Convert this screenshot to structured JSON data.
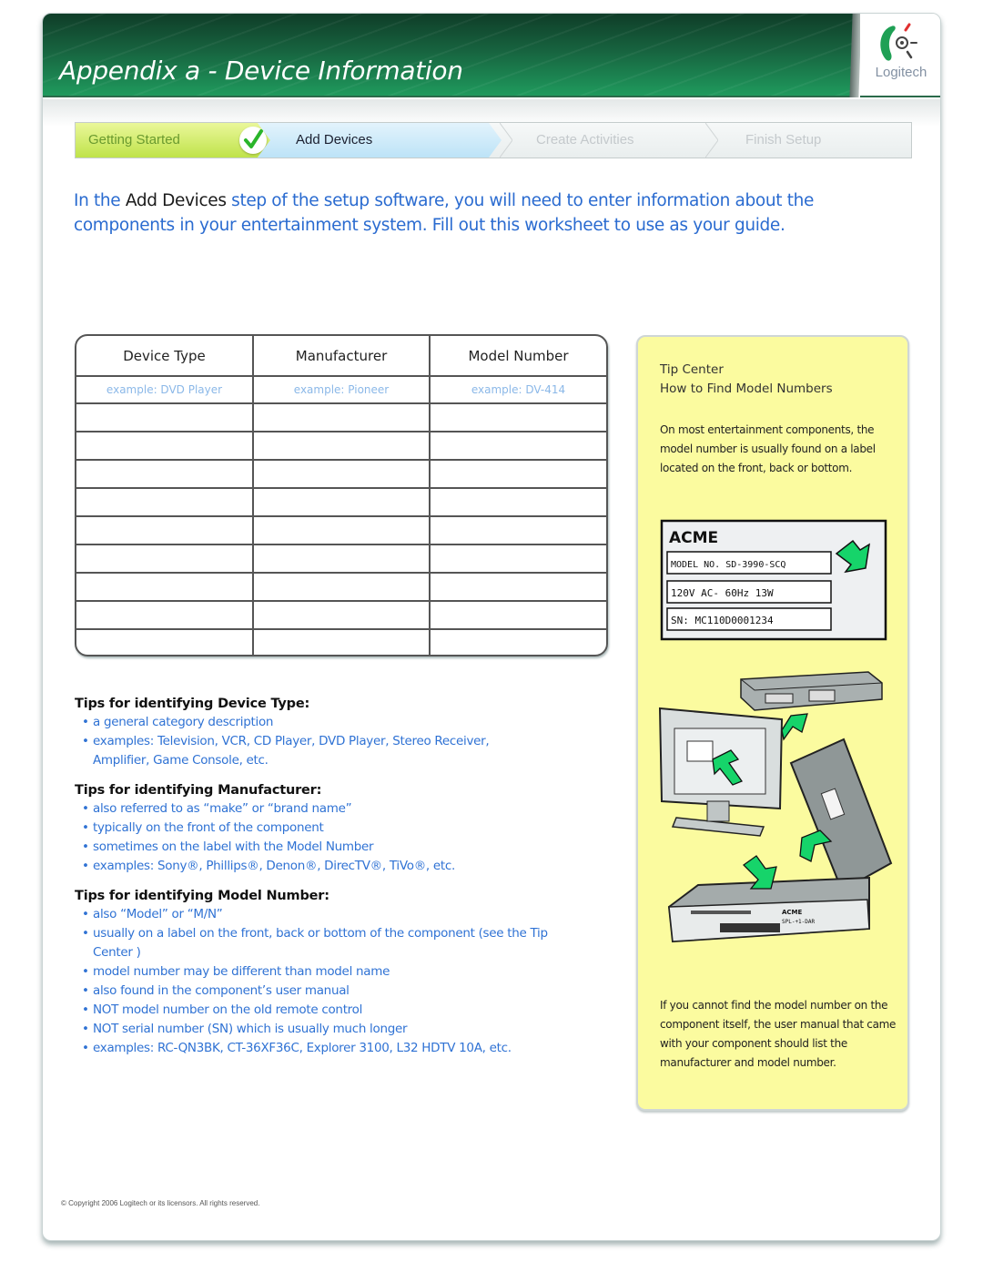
{
  "header": {
    "title": "Appendix a - Device Information",
    "logo_text": "Logitech"
  },
  "steps": [
    {
      "label": "Getting Started",
      "state": "completed"
    },
    {
      "label": "Add Devices",
      "state": "current"
    },
    {
      "label": "Create Activities",
      "state": "upcoming"
    },
    {
      "label": "Finish Setup",
      "state": "upcoming"
    }
  ],
  "intro": {
    "pre": "In the ",
    "emphasis": "Add Devices",
    "post": " step of the setup software, you will need to enter information about the components in your entertainment system. Fill out this worksheet to use as your guide."
  },
  "worksheet": {
    "columns": [
      "Device Type",
      "Manufacturer",
      "Model Number"
    ],
    "example": [
      "example: DVD Player",
      "example: Pioneer",
      "example: DV-414"
    ],
    "blank_rows": 9
  },
  "tips": [
    {
      "heading": "Tips for identifying Device Type:",
      "items": [
        "a general category description",
        "examples: Television, VCR, CD Player, DVD Player, Stereo Receiver, Amplifier, Game Console, etc."
      ]
    },
    {
      "heading": "Tips for identifying Manufacturer:",
      "items": [
        "also referred to as “make” or “brand name”",
        "typically on the front of the component",
        "sometimes on the label with the Model Number",
        "examples: Sony®, Phillips®, Denon®, DirecTV®, TiVo®, etc."
      ]
    },
    {
      "heading": "Tips for identifying Model Number:",
      "items": [
        "also “Model” or “M/N”",
        "usually on a label on the front, back or bottom of the component (see the Tip Center )",
        "model number may be different than model name",
        "also found in the component’s user manual",
        "NOT model number on the old remote control",
        "NOT serial number (SN) which is usually much longer",
        "examples: RC-QN3BK, CT-36XF36C, Explorer 3100, L32 HDTV 10A, etc."
      ]
    }
  ],
  "tip_center": {
    "title": "Tip Center",
    "subtitle": "How to Find Model Numbers",
    "paragraph1": "On most entertainment components, the model number is usually found on a label located on the front, back or bottom.",
    "label_brand": "ACME",
    "label_model": "MODEL NO. SD-3990-SCQ",
    "label_power": "120V AC- 60Hz 13W",
    "label_serial": "SN: MC110D0001234",
    "device_brand": "ACME",
    "device_model": "SPL-+1-DAR",
    "paragraph2": "If you cannot find the model number on the component itself, the user manual that came with your component should list the manufacturer and model number."
  },
  "footer": {
    "copyright": "© Copyright 2006 Logitech or its licensors. All rights reserved."
  },
  "colors": {
    "banner_green": "#1f9a5d",
    "intro_blue": "#2a6bd0",
    "tip_yellow": "#fbfb9f",
    "arrow_green": "#16d46a"
  }
}
